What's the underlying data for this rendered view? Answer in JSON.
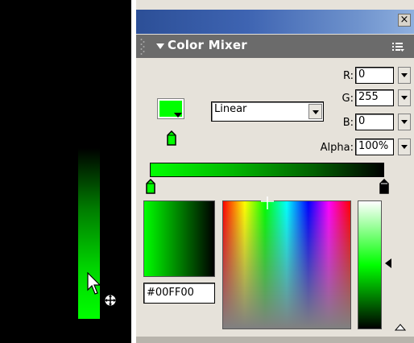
{
  "panel": {
    "title": "Color Mixer",
    "close_glyph": "×",
    "icons": {
      "close": "close-icon",
      "collapse": "triangle-down-icon",
      "options": "options-menu-icon",
      "gripper": "gripper-icon",
      "expand": "triangle-up-icon"
    }
  },
  "rgb": {
    "r_label": "R:",
    "r_value": "0",
    "g_label": "G:",
    "g_value": "255",
    "b_label": "B:",
    "b_value": "0",
    "alpha_label": "Alpha:",
    "alpha_value": "100%"
  },
  "fill_type": {
    "selected": "Linear"
  },
  "hex": {
    "value": "#00FF00"
  },
  "colors": {
    "fill": "#00ff00",
    "gradient_start": "#00ff00",
    "gradient_end": "#000000",
    "titlebar": "#3e64b2",
    "header": "#6b6b6b",
    "panel_bg": "#e6e2da"
  },
  "gradient": {
    "pointers": [
      {
        "position": 0,
        "color": "#00ff00"
      },
      {
        "position": 1,
        "color": "#000000"
      }
    ]
  }
}
